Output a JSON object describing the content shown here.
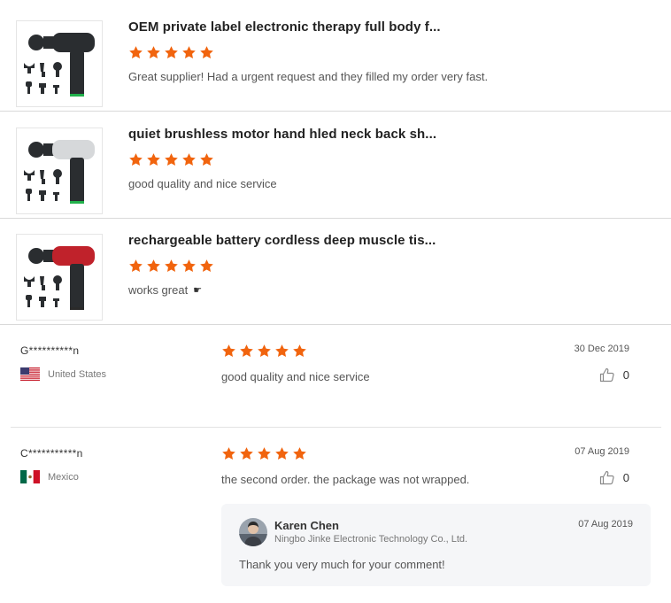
{
  "colors": {
    "star": "#f1640e",
    "divider": "#e3e3e3",
    "reply_bg": "#f5f6f8"
  },
  "products": [
    {
      "title": "OEM private label electronic therapy full body f...",
      "rating": 5,
      "comment": "Great supplier! Had a urgent request and they filled my order very fast.",
      "image_icon": "massage-gun-black",
      "gun_color": "#2a2d30",
      "accent_color": "#22b14c"
    },
    {
      "title": "quiet brushless motor hand hled neck back sh...",
      "rating": 5,
      "comment": "good quality and nice service",
      "image_icon": "massage-gun-silver",
      "gun_color": "#d6d8da",
      "accent_color": "#22b14c"
    },
    {
      "title": "rechargeable battery cordless deep muscle tis...",
      "rating": 5,
      "comment": "works great",
      "image_icon": "massage-gun-red",
      "gun_color": "#c0222b",
      "accent_color": "#2a2a2a"
    }
  ],
  "reviews": [
    {
      "user": "G**********n",
      "country": "United States",
      "flag_icon": "us-flag-icon",
      "rating": 5,
      "text": "good quality and nice service",
      "date": "30 Dec 2019",
      "likes": "0"
    },
    {
      "user": "C***********n",
      "country": "Mexico",
      "flag_icon": "mexico-flag-icon",
      "rating": 5,
      "text": "the second order. the package was not wrapped.",
      "date": "07 Aug 2019",
      "likes": "0",
      "reply": {
        "name": "Karen Chen",
        "company": "Ningbo Jinke Electronic Technology Co., Ltd.",
        "date": "07 Aug 2019",
        "text": "Thank you very much for your comment!"
      }
    }
  ]
}
